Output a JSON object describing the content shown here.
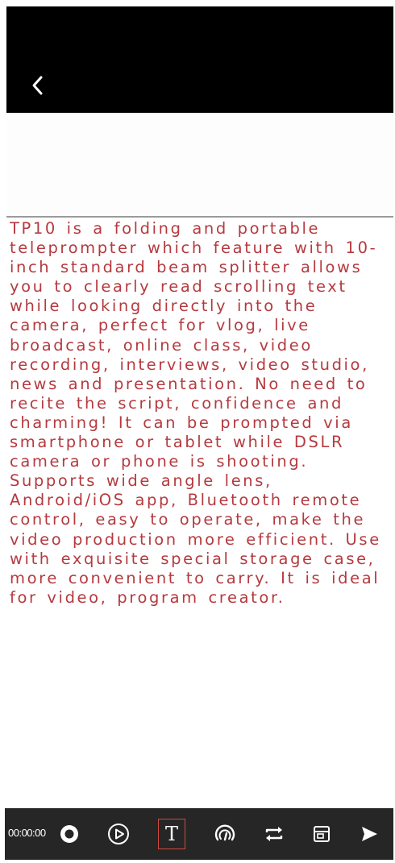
{
  "header": {
    "back_icon": "chevron-left-icon"
  },
  "script": {
    "text": "TP10 is a folding and portable teleprompter which feature with 10-inch standard beam splitter allows you to clearly read scrolling text while looking directly into the camera, perfect for vlog, live broadcast, online class, video recording, interviews, video studio, news and presentation. No need to recite the script, confidence and charming! It can be prompted via smartphone or tablet while DSLR camera or phone is shooting. Supports wide angle lens, Android/iOS app, Bluetooth remote control, easy to operate, make the video production more efficient. Use with exquisite special storage case, more convenient to carry. It is ideal for video, program creator.",
    "color": "#b53a3f"
  },
  "toolbar": {
    "timer": "00:00:00",
    "icons": [
      "record-icon",
      "play-icon",
      "text-icon",
      "speed-gauge-icon",
      "loop-icon",
      "mirror-icon",
      "send-icon"
    ],
    "text_button_glyph": "T",
    "active_color": "#d0493f",
    "background": "#262626"
  }
}
